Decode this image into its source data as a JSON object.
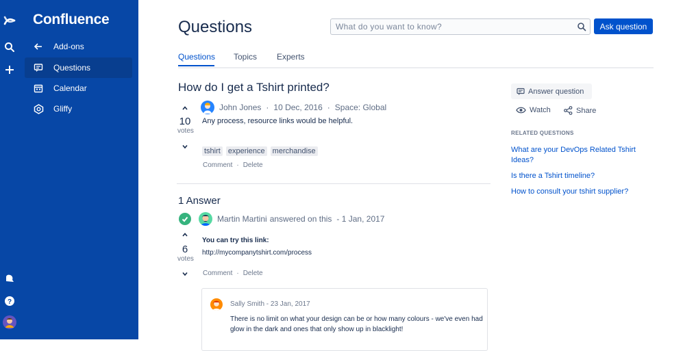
{
  "brand": {
    "name": "Confluence"
  },
  "sidebar": {
    "items": [
      {
        "label": "Add-ons",
        "icon": "arrow-left-icon"
      },
      {
        "label": "Questions",
        "icon": "questions-icon",
        "active": true
      },
      {
        "label": "Calendar",
        "icon": "calendar-icon"
      },
      {
        "label": "Gliffy",
        "icon": "gliffy-icon"
      }
    ]
  },
  "header": {
    "title": "Questions",
    "search_placeholder": "What do you want to know?",
    "ask_label": "Ask question"
  },
  "tabs": [
    {
      "label": "Questions",
      "active": true
    },
    {
      "label": "Topics"
    },
    {
      "label": "Experts"
    }
  ],
  "question": {
    "title": "How do I get a Tshirt printed?",
    "votes": "10",
    "votes_label": "votes",
    "author": "John Jones",
    "date": "10 Dec, 2016",
    "space": "Space: Global",
    "body": "Any process, resource links would be helpful.",
    "tags": [
      "tshirt",
      "experience",
      "merchandise"
    ],
    "comment_label": "Comment",
    "delete_label": "Delete"
  },
  "answers": {
    "count_label": "1 Answer",
    "items": [
      {
        "author": "Martin Martini",
        "answered_text": "answered on this",
        "date": "- 1 Jan, 2017",
        "votes": "6",
        "votes_label": "votes",
        "lead": "You can try this link:",
        "link": "http://mycompanytshirt.com/process",
        "comment_label": "Comment",
        "delete_label": "Delete",
        "comment": {
          "author": "Sally Smith",
          "date": "- 23 Jan, 2017",
          "text": "There is no limit on what your design can be or how many colours - we've even had glow in the dark and ones that only show up in blacklight!"
        }
      }
    ]
  },
  "right_panel": {
    "answer_label": "Answer question",
    "watch_label": "Watch",
    "share_label": "Share",
    "related_heading": "RELATED QUESTIONS",
    "related": [
      "What are your DevOps Related Tshirt Ideas?",
      "Is there a Tshirt timeline?",
      "How to consult your tshirt supplier?"
    ]
  },
  "colors": {
    "nav": "#0747a6",
    "accent": "#0052cc",
    "accepted": "#36b37e"
  }
}
